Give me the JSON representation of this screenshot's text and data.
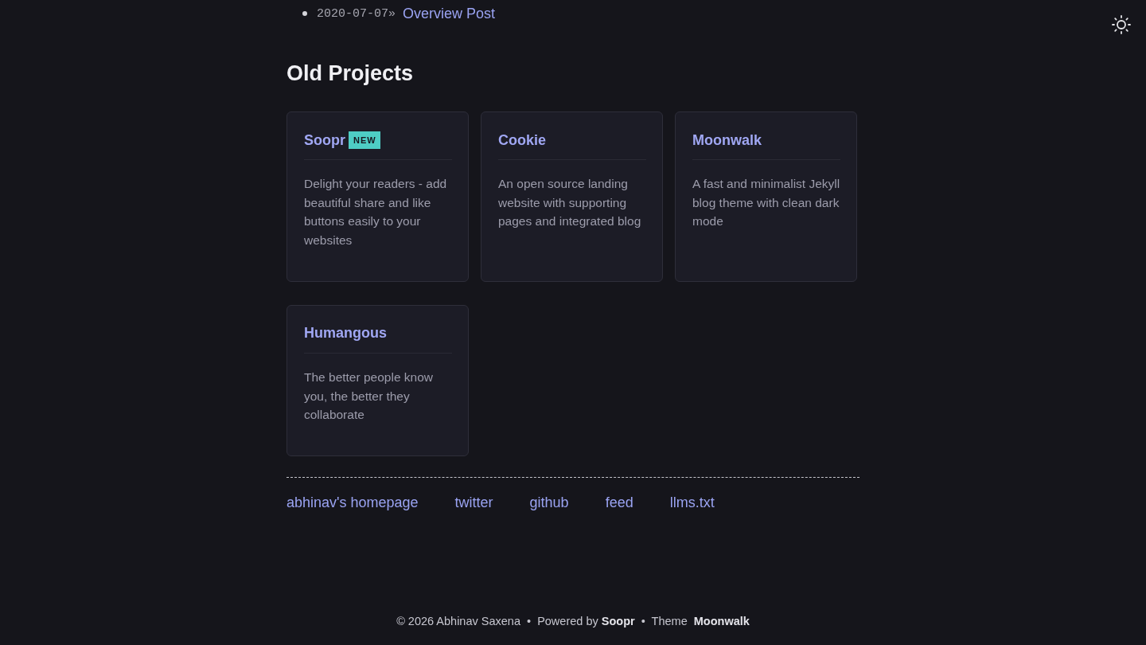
{
  "posts": [
    {
      "date": "2020-07-07»",
      "title": "Overview Post"
    }
  ],
  "section": {
    "title": "Old Projects"
  },
  "projects": [
    {
      "name": "Soopr",
      "badge": "NEW",
      "description": "Delight your readers - add beautiful share and like buttons easily to your websites"
    },
    {
      "name": "Cookie",
      "description": "An open source landing website with supporting pages and integrated blog"
    },
    {
      "name": "Moonwalk",
      "description": "A fast and minimalist Jekyll blog theme with clean dark mode"
    },
    {
      "name": "Humangous",
      "description": "The better people know you, the better they collaborate"
    }
  ],
  "footer_links": [
    "abhinav's homepage",
    "twitter",
    "github",
    "feed",
    "llms.txt"
  ],
  "copyright": "© 2026 Abhinav Saxena  •  Powered by **Soopr**  •  Theme  **Moonwalk**"
}
